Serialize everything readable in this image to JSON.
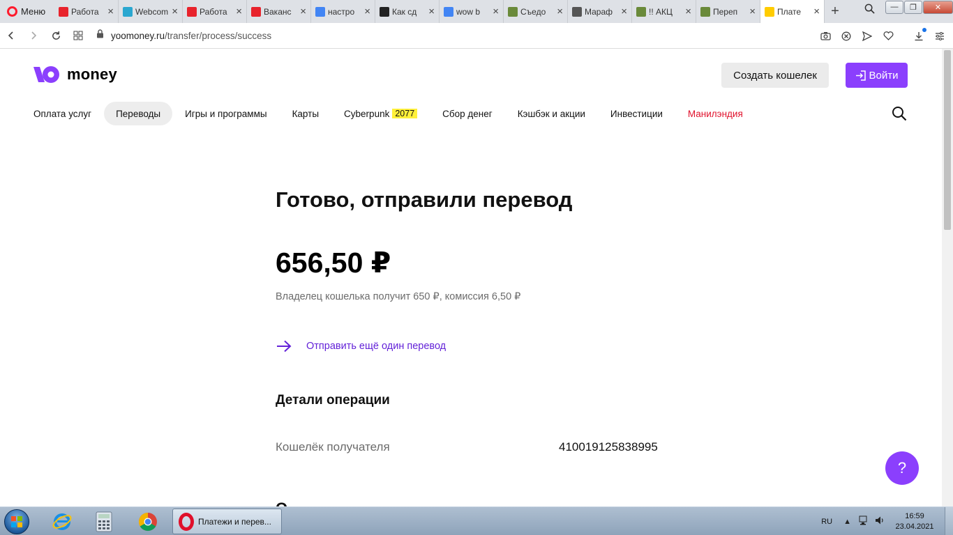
{
  "browser": {
    "menu_label": "Меню",
    "tabs": [
      {
        "title": "Работа",
        "icon": "rabota-r-icon",
        "color": "#e8232c"
      },
      {
        "title": "Webcom",
        "icon": "webcom-w-icon",
        "color": "#2aa7d0"
      },
      {
        "title": "Работа",
        "icon": "rabota-r-icon",
        "color": "#e8232c"
      },
      {
        "title": "Ваканс",
        "icon": "rabota-r-icon",
        "color": "#e8232c"
      },
      {
        "title": "настро",
        "icon": "google-g-icon",
        "color": "#4285f4"
      },
      {
        "title": "Как сд",
        "icon": "wiki-w-icon",
        "color": "#222222"
      },
      {
        "title": "wow b",
        "icon": "google-g-icon",
        "color": "#4285f4"
      },
      {
        "title": "Съедо",
        "icon": "globe-icon",
        "color": "#6a8a3a"
      },
      {
        "title": "Мараф",
        "icon": "t-circle-icon",
        "color": "#555555"
      },
      {
        "title": "!! АКЦ",
        "icon": "globe-icon",
        "color": "#6a8a3a"
      },
      {
        "title": "Переп",
        "icon": "globe-icon",
        "color": "#6a8a3a"
      },
      {
        "title": "Плате",
        "icon": "yoomoney-icon",
        "color": "#ffcc00"
      }
    ],
    "url_domain": "yoomoney.ru",
    "url_path": "/transfer/process/success"
  },
  "header": {
    "logo_text": "money",
    "create_wallet": "Создать кошелек",
    "login": "Войти"
  },
  "nav": {
    "items": [
      "Оплата услуг",
      "Переводы",
      "Игры и программы",
      "Карты",
      "Cyberpunk",
      "Сбор денег",
      "Кэшбэк и акции",
      "Инвестиции",
      "Манилэндия"
    ],
    "badge": "2077",
    "active_index": 1
  },
  "content": {
    "title": "Готово, отправили перевод",
    "amount": "656,50 ₽",
    "subtext": "Владелец кошелька получит 650 ₽, комиссия 6,50 ₽",
    "send_again": "Отправить ещё один перевод",
    "details_heading": "Детали операции",
    "recipient_label": "Кошелёк получателя",
    "recipient_value": "410019125838995",
    "help_label": "?"
  },
  "taskbar": {
    "task_label": "Платежи и перев...",
    "lang": "RU",
    "time": "16:59",
    "date": "23.04.2021"
  },
  "colors": {
    "brand_purple": "#8b3ffd",
    "link_purple": "#6322d8",
    "badge_yellow": "#fff03a",
    "alert_red": "#e0102b"
  }
}
